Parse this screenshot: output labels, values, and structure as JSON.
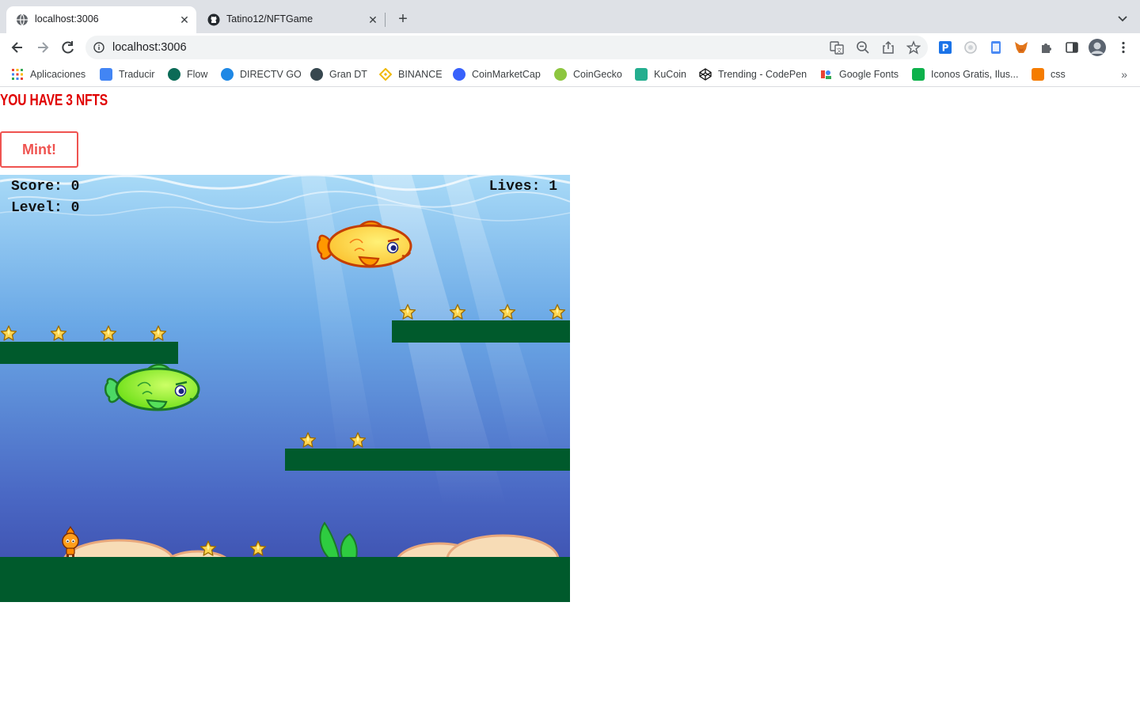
{
  "browser": {
    "tabs": [
      {
        "title": "localhost:3006",
        "active": true,
        "icon": "globe-icon"
      },
      {
        "title": "Tatino12/NFTGame",
        "active": false,
        "icon": "github-icon"
      }
    ],
    "url": "localhost:3006",
    "bookmarks": [
      {
        "label": "Aplicaciones",
        "icon": "apps-grid-icon",
        "color": "#4285f4"
      },
      {
        "label": "Traducir",
        "icon": "translate-icon",
        "color": "#4285f4"
      },
      {
        "label": "Flow",
        "icon": "flow-icon",
        "color": "#0b6b57"
      },
      {
        "label": "DIRECTV GO",
        "icon": "directv-icon",
        "color": "#1e88e5"
      },
      {
        "label": "Gran DT",
        "icon": "ball-icon",
        "color": "#37474f"
      },
      {
        "label": "BINANCE",
        "icon": "binance-icon",
        "color": "#f0b90b"
      },
      {
        "label": "CoinMarketCap",
        "icon": "coinmarketcap-icon",
        "color": "#3861fb"
      },
      {
        "label": "CoinGecko",
        "icon": "coingecko-icon",
        "color": "#8dc63f"
      },
      {
        "label": "KuCoin",
        "icon": "kucoin-icon",
        "color": "#24ae8f"
      },
      {
        "label": "Trending - CodePen",
        "icon": "codepen-icon",
        "color": "#111111"
      },
      {
        "label": "Google Fonts",
        "icon": "google-fonts-icon",
        "color": "#ea4335"
      },
      {
        "label": "Iconos Gratis, Ilus...",
        "icon": "flaticon-icon",
        "color": "#0db14b"
      },
      {
        "label": "css",
        "icon": "w3schools-icon",
        "color": "#f57c00"
      }
    ]
  },
  "page": {
    "nft_message": "YOU HAVE 3 NFTS",
    "mint_label": "Mint!"
  },
  "game": {
    "score_text": "Score: 0",
    "level_text": "Level: 0",
    "lives_text": "Lives: 1",
    "colors": {
      "water_top": "#9fd3f5",
      "water_bottom": "#3b4fb0",
      "platform": "#005a2c",
      "star": "#ffd54f",
      "sand": "#f7dcb6"
    }
  }
}
